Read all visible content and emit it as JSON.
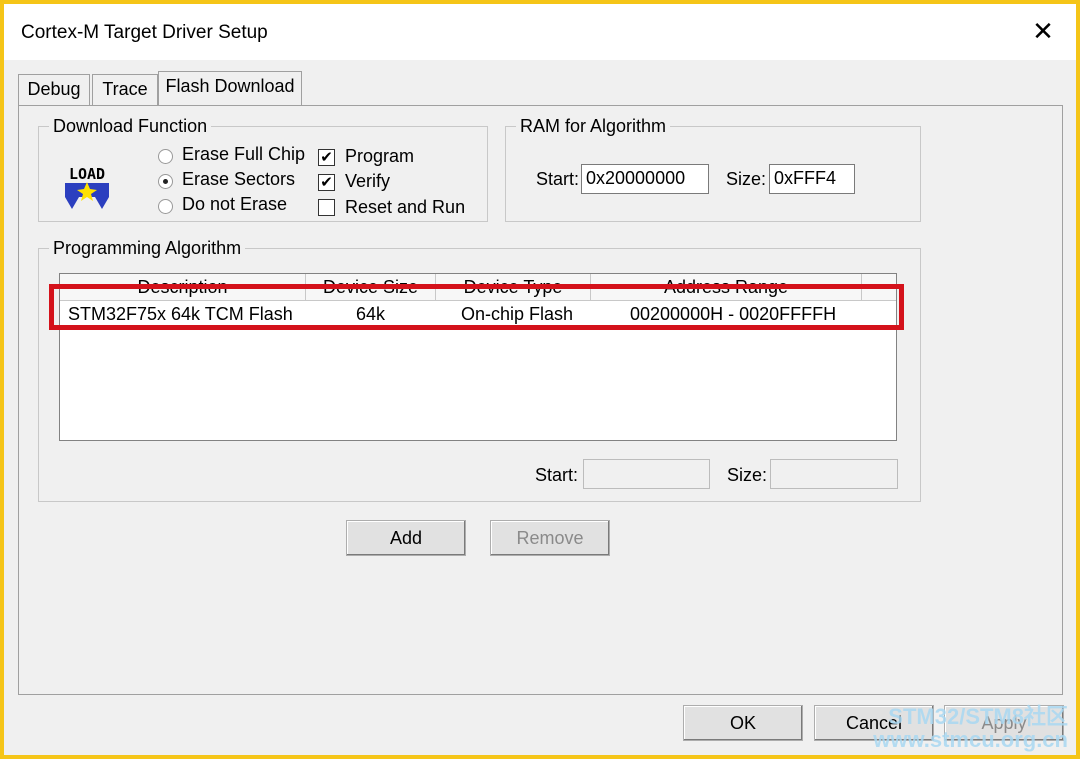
{
  "window": {
    "title": "Cortex-M Target Driver Setup",
    "close_glyph": "✕"
  },
  "tabs": [
    {
      "label": "Debug"
    },
    {
      "label": "Trace"
    },
    {
      "label": "Flash Download"
    }
  ],
  "active_tab": "Flash Download",
  "download_function": {
    "title": "Download Function",
    "icon": "load-icon",
    "icon_text": "LOAD",
    "options": [
      {
        "label": "Erase Full Chip",
        "checked": false
      },
      {
        "label": "Erase Sectors",
        "checked": true
      },
      {
        "label": "Do not Erase",
        "checked": false
      }
    ],
    "checks": [
      {
        "label": "Program",
        "checked": true,
        "mark": "✔"
      },
      {
        "label": "Verify",
        "checked": true,
        "mark": "✔"
      },
      {
        "label": "Reset and Run",
        "checked": false,
        "mark": ""
      }
    ]
  },
  "ram": {
    "title": "RAM for Algorithm",
    "start_label": "Start:",
    "start_value": "0x20000000",
    "size_label": "Size:",
    "size_value": "0xFFF4"
  },
  "algorithm": {
    "title": "Programming Algorithm",
    "columns": [
      "Description",
      "Device Size",
      "Device Type",
      "Address Range"
    ],
    "rows": [
      {
        "description": "STM32F75x 64k TCM Flash",
        "size": "64k",
        "type": "On-chip Flash",
        "range": "00200000H - 0020FFFFH"
      }
    ],
    "start_label": "Start:",
    "start_value": "",
    "size_label": "Size:",
    "size_value": ""
  },
  "buttons": {
    "add": "Add",
    "remove": "Remove",
    "ok": "OK",
    "cancel": "Cancel",
    "apply": "Apply"
  },
  "watermark": {
    "line1": "STM32/STM8社区",
    "line2": "www.stmcu.org.cn"
  },
  "colors": {
    "highlight": "#d4121b",
    "frame": "#f5c518",
    "watermark": "#a9d8f2"
  }
}
